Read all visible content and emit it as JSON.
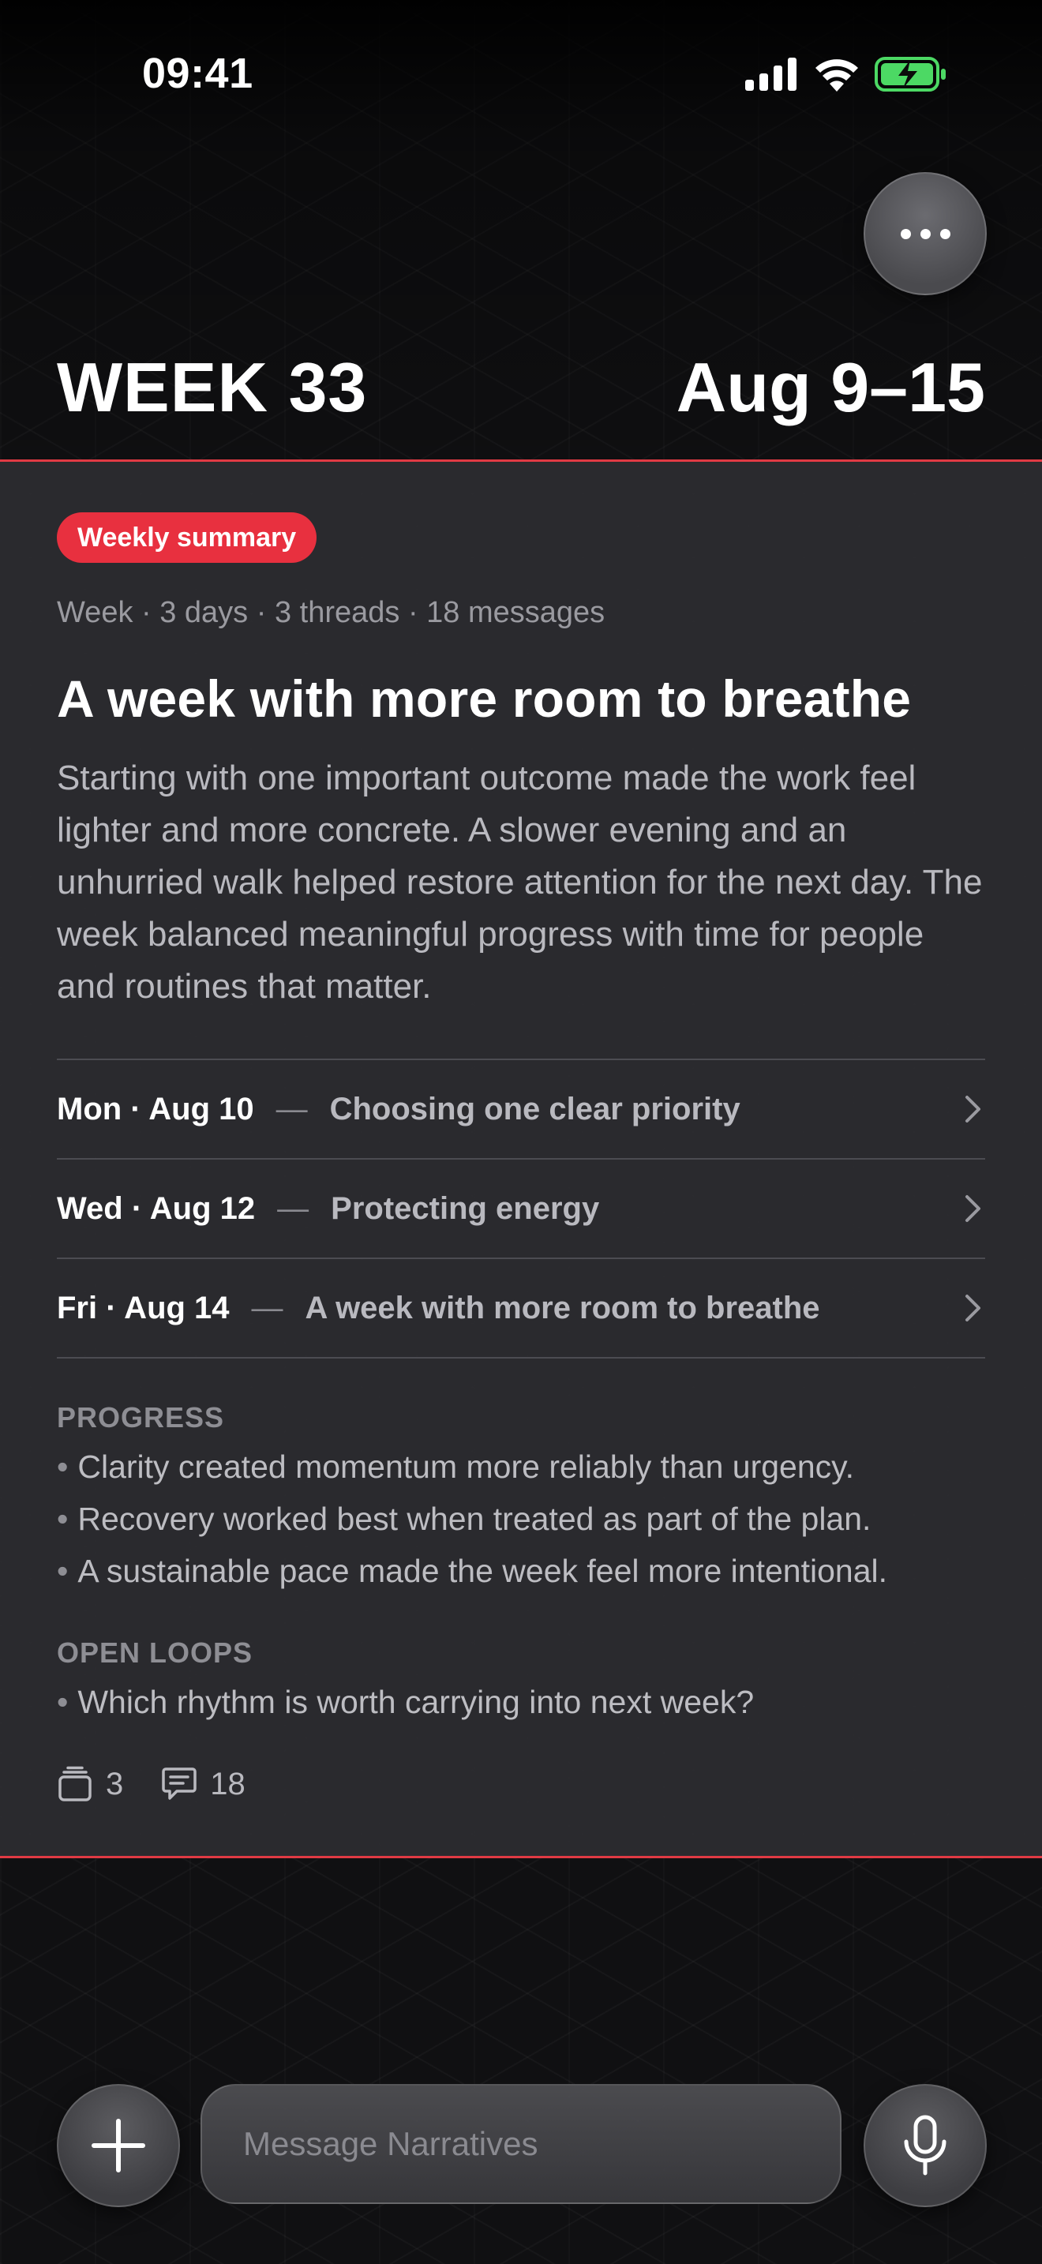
{
  "status_bar": {
    "time": "09:41",
    "icons": [
      "signal-icon",
      "wifi-icon",
      "battery-charging-icon"
    ],
    "battery_color": "#4cd964"
  },
  "header": {
    "week_label": "WEEK 33",
    "date_range": "Aug 9–15",
    "more_icon": "ellipsis-icon"
  },
  "summary_card": {
    "accent_color": "#e8303f",
    "badge": "Weekly summary",
    "meta": "Week · 3 days · 3 threads · 18 messages",
    "headline": "A week with more room to breathe",
    "body": "Starting with one important outcome made the work feel lighter and more concrete. A slower evening and an unhurried walk helped restore attention for the next day. The week balanced meaningful progress with time for people and routines that matter.",
    "threads": [
      {
        "date": "Mon · Aug 10",
        "separator": "—",
        "title": "Choosing one clear priority"
      },
      {
        "date": "Wed · Aug 12",
        "separator": "—",
        "title": "Protecting energy"
      },
      {
        "date": "Fri · Aug 14",
        "separator": "—",
        "title": "A week with more room to breathe"
      }
    ],
    "progress": {
      "label": "PROGRESS",
      "items": [
        "Clarity created momentum more reliably than urgency.",
        "Recovery worked best when treated as part of the plan.",
        "A sustainable pace made the week feel more intentional."
      ]
    },
    "open_loops": {
      "label": "OPEN LOOPS",
      "items": [
        "Which rhythm is worth carrying into next week?"
      ]
    },
    "counts": {
      "threads": "3",
      "messages": "18"
    }
  },
  "composer": {
    "placeholder": "Message Narratives",
    "add_icon": "plus-icon",
    "mic_icon": "microphone-icon"
  }
}
